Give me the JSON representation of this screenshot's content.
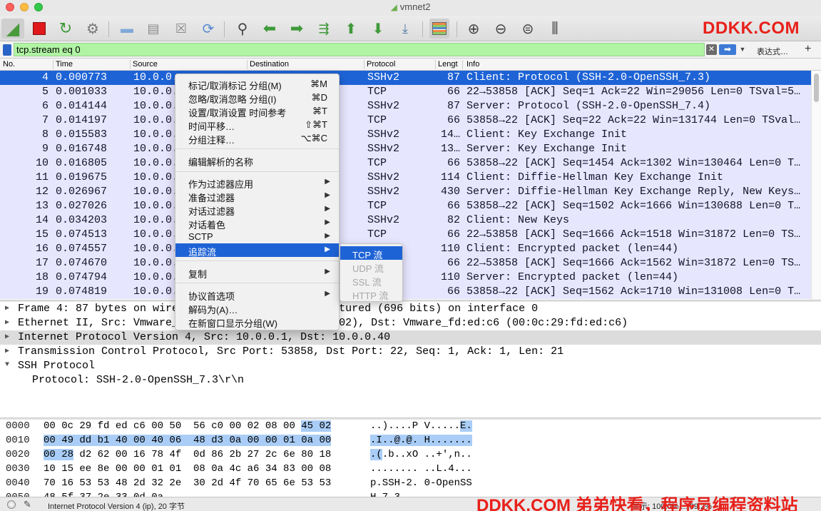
{
  "window": {
    "title": "vmnet2"
  },
  "watermarks": {
    "top": "DDKK.COM",
    "bottom": "DDKK.COM 弟弟快看，程序员编程资料站"
  },
  "toolbar": {
    "icons": [
      "shark-fin-icon",
      "stop-icon",
      "restart-icon",
      "options-icon",
      "open-icon",
      "save-icon",
      "close-icon",
      "reload-icon",
      "find-icon",
      "back-icon",
      "forward-icon",
      "goto-icon",
      "first-icon",
      "last-icon",
      "autoscroll-icon",
      "colorize-icon",
      "zoom-in-icon",
      "zoom-out-icon",
      "zoom-normal-icon",
      "resize-columns-icon"
    ]
  },
  "filter": {
    "value": "tcp.stream eq 0",
    "expression_label": "表达式…",
    "add_label": "+"
  },
  "packet_list": {
    "headers": {
      "no": "No.",
      "time": "Time",
      "source": "Source",
      "destination": "Destination",
      "protocol": "Protocol",
      "length": "Lengt",
      "info": "Info"
    },
    "rows": [
      {
        "no": "4",
        "time": "0.000773",
        "src": "10.0.0.",
        "proto": "SSHv2",
        "len": "87",
        "info": "Client: Protocol (SSH-2.0-OpenSSH_7.3)"
      },
      {
        "no": "5",
        "time": "0.001033",
        "src": "10.0.0.",
        "proto": "TCP",
        "len": "66",
        "info": "22→53858 [ACK] Seq=1 Ack=22 Win=29056 Len=0 TSval=5…"
      },
      {
        "no": "6",
        "time": "0.014144",
        "src": "10.0.0.",
        "proto": "SSHv2",
        "len": "87",
        "info": "Server: Protocol (SSH-2.0-OpenSSH_7.4)"
      },
      {
        "no": "7",
        "time": "0.014197",
        "src": "10.0.0.",
        "proto": "TCP",
        "len": "66",
        "info": "53858→22 [ACK] Seq=22 Ack=22 Win=131744 Len=0 TSval…"
      },
      {
        "no": "8",
        "time": "0.015583",
        "src": "10.0.0.",
        "proto": "SSHv2",
        "len": "14…",
        "info": "Client: Key Exchange Init"
      },
      {
        "no": "9",
        "time": "0.016748",
        "src": "10.0.0.",
        "proto": "SSHv2",
        "len": "13…",
        "info": "Server: Key Exchange Init"
      },
      {
        "no": "10",
        "time": "0.016805",
        "src": "10.0.0.",
        "proto": "TCP",
        "len": "66",
        "info": "53858→22 [ACK] Seq=1454 Ack=1302 Win=130464 Len=0 T…"
      },
      {
        "no": "11",
        "time": "0.019675",
        "src": "10.0.0.",
        "proto": "SSHv2",
        "len": "114",
        "info": "Client: Diffie-Hellman Key Exchange Init"
      },
      {
        "no": "12",
        "time": "0.026967",
        "src": "10.0.0.",
        "proto": "SSHv2",
        "len": "430",
        "info": "Server: Diffie-Hellman Key Exchange Reply, New Keys…"
      },
      {
        "no": "13",
        "time": "0.027026",
        "src": "10.0.0.",
        "proto": "TCP",
        "len": "66",
        "info": "53858→22 [ACK] Seq=1502 Ack=1666 Win=130688 Len=0 T…"
      },
      {
        "no": "14",
        "time": "0.034203",
        "src": "10.0.0.",
        "proto": "SSHv2",
        "len": "82",
        "info": "Client: New Keys"
      },
      {
        "no": "15",
        "time": "0.074513",
        "src": "10.0.0.",
        "proto": "TCP",
        "len": "66",
        "info": "22→53858 [ACK] Seq=1666 Ack=1518 Win=31872 Len=0 TS…"
      },
      {
        "no": "16",
        "time": "0.074557",
        "src": "10.0.0.",
        "proto": "",
        "len": "110",
        "info": "Client: Encrypted packet (len=44)"
      },
      {
        "no": "17",
        "time": "0.074670",
        "src": "10.0.0.",
        "proto": "",
        "len": "66",
        "info": "22→53858 [ACK] Seq=1666 Ack=1562 Win=31872 Len=0 TS…"
      },
      {
        "no": "18",
        "time": "0.074794",
        "src": "10.0.0.",
        "proto": "",
        "len": "110",
        "info": "Server: Encrypted packet (len=44)"
      },
      {
        "no": "19",
        "time": "0.074819",
        "src": "10.0.0.",
        "proto": "",
        "len": "66",
        "info": "53858→22 [ACK] Seq=1562 Ack=1710 Win=131008 Len=0 T…"
      }
    ]
  },
  "details": {
    "rows": [
      {
        "arrow": "▶",
        "text": "Frame 4: 87 bytes on wire (696 bits), 87 bytes captured (696 bits) on interface 0"
      },
      {
        "arrow": "▶",
        "text": "Ethernet II, Src: Vmware_c0:00:02 (00:50:56:c0:00:02), Dst: Vmware_fd:ed:c6 (00:0c:29:fd:ed:c6)"
      },
      {
        "arrow": "▶",
        "text": "Internet Protocol Version 4, Src: 10.0.0.1, Dst: 10.0.0.40"
      },
      {
        "arrow": "▶",
        "text": "Transmission Control Protocol, Src Port: 53858, Dst Port: 22, Seq: 1, Ack: 1, Len: 21"
      },
      {
        "arrow": "▼",
        "text": "SSH Protocol"
      },
      {
        "arrow": "",
        "text": "Protocol: SSH-2.0-OpenSSH_7.3\\r\\n"
      }
    ]
  },
  "bytes": {
    "rows": [
      {
        "off": "0000",
        "hex": "00 0c 29 fd ed c6 00 50  56 c0 00 02 08 00 ",
        "hex_hl": "45 02",
        "asc": "..)....P V.....",
        "asc_hl": "E."
      },
      {
        "off": "0010",
        "hex": "",
        "hex_hl": "00 49 dd b1 40 00 40 06  48 d3 0a 00 00 01 0a 00",
        "asc": "",
        "asc_hl": ".I..@.@. H......."
      },
      {
        "off": "0020",
        "hex_hl": "00 28",
        "hex": " d2 62 00 16 78 4f  0d 86 2b 27 2c 6e 80 18",
        "asc_hl": ".(",
        "asc": ".b..xO ..+',n.."
      },
      {
        "off": "0030",
        "hex": "10 15 ee 8e 00 00 01 01  08 0a 4c a6 34 83 00 08",
        "hex_hl": "",
        "asc": "........ ..L.4...",
        "asc_hl": ""
      },
      {
        "off": "0040",
        "hex": "70 16 53 53 48 2d 32 2e  30 2d 4f 70 65 6e 53 53",
        "hex_hl": "",
        "asc": "p.SSH-2. 0-OpenSS",
        "asc_hl": ""
      },
      {
        "off": "0050",
        "hex": "48 5f 37 2e 33 0d 0a",
        "hex_hl": "",
        "asc": "H_7.3..",
        "asc_hl": ""
      }
    ]
  },
  "status": {
    "text": "Internet Protocol Version 4 (ip), 20 字节",
    "profile": "显示: 100.0%   ... 89.2%"
  },
  "context_menu": {
    "items": [
      {
        "label": "标记/取消标记 分组(M)",
        "shortcut": "⌘M"
      },
      {
        "label": "忽略/取消忽略 分组(I)",
        "shortcut": "⌘D"
      },
      {
        "label": "设置/取消设置 时间参考",
        "shortcut": "⌘T"
      },
      {
        "label": "时间平移…",
        "shortcut": "⇧⌘T"
      },
      {
        "label": "分组注释…",
        "shortcut": "⌥⌘C"
      },
      {
        "label": "编辑解析的名称",
        "shortcut": ""
      },
      {
        "label": "作为过滤器应用",
        "submenu": "▶"
      },
      {
        "label": "准备过滤器",
        "submenu": "▶"
      },
      {
        "label": "对话过滤器",
        "submenu": "▶"
      },
      {
        "label": "对话着色",
        "submenu": "▶"
      },
      {
        "label": "SCTP",
        "submenu": "▶"
      },
      {
        "label": "追踪流",
        "submenu": "▶"
      },
      {
        "label": "复制",
        "submenu": "▶"
      },
      {
        "label": "协议首选项",
        "submenu": "▶"
      },
      {
        "label": "解码为(A)…",
        "shortcut": ""
      },
      {
        "label": "在新窗口显示分组(W)",
        "shortcut": ""
      }
    ],
    "submenu": [
      {
        "label": "TCP 流",
        "enabled": true
      },
      {
        "label": "UDP 流",
        "enabled": false
      },
      {
        "label": "SSL 流",
        "enabled": false
      },
      {
        "label": "HTTP 流",
        "enabled": false
      }
    ]
  }
}
